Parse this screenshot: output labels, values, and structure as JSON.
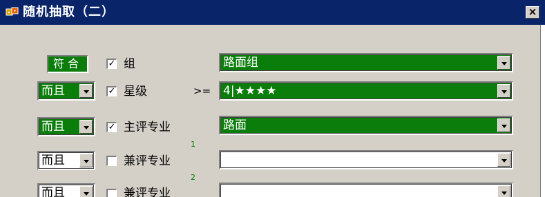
{
  "window": {
    "title": "随机抽取（二）",
    "close_label": "×",
    "title_icon": "dice-icon"
  },
  "rows": [
    {
      "op": "符合",
      "checked": true,
      "check_mark": "✓",
      "label": "组",
      "operator": "",
      "value": "路面组",
      "value_style": "green"
    },
    {
      "op": "而且",
      "checked": true,
      "check_mark": "✓",
      "label": "星级",
      "operator": ">=",
      "value": "4|★★★★",
      "value_style": "green"
    },
    {
      "op": "而且",
      "checked": true,
      "check_mark": "✓",
      "label": "主评专业",
      "operator": "",
      "value": "路面",
      "value_style": "green"
    },
    {
      "op": "而且",
      "checked": false,
      "check_mark": "",
      "label": "兼评专业",
      "superscript": "1",
      "value": "",
      "value_style": "white"
    },
    {
      "op": "而且",
      "checked": false,
      "check_mark": "",
      "label": "兼评专业",
      "superscript": "2",
      "value": "",
      "value_style": "white"
    }
  ],
  "colors": {
    "titlebar": "#0a246a",
    "selected_green": "#0a7d0a",
    "dialog_face": "#d4d0c8"
  }
}
